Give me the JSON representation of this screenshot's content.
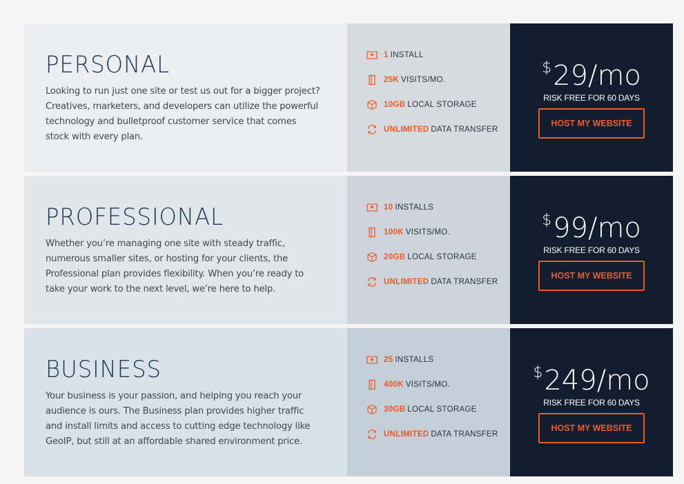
{
  "accent_color": "#ee5a24",
  "plans": [
    {
      "name": "PERSONAL",
      "description": "Looking to run just one site or test us out for a bigger project? Creatives, marketers, and developers can utilize the powerful technology and bulletproof customer service that comes stock with every plan.",
      "features": [
        {
          "icon": "install-icon",
          "value": "1",
          "label": "INSTALL"
        },
        {
          "icon": "visits-icon",
          "value": "25K",
          "label": "VISITS/MO."
        },
        {
          "icon": "storage-icon",
          "value": "10GB",
          "label": "LOCAL STORAGE"
        },
        {
          "icon": "transfer-icon",
          "value": "UNLIMITED",
          "label": "DATA TRANSFER"
        }
      ],
      "currency": "$",
      "price": "29",
      "period": "/mo",
      "guarantee": "RISK FREE FOR 60 DAYS",
      "cta": "HOST MY WEBSITE"
    },
    {
      "name": "PROFESSIONAL",
      "description": "Whether you’re managing one site with steady traffic, numerous smaller sites, or hosting for your clients, the Professional plan provides flexibility. When you’re ready to take your work to the next level, we’re here to help.",
      "features": [
        {
          "icon": "install-icon",
          "value": "10",
          "label": "INSTALLS"
        },
        {
          "icon": "visits-icon",
          "value": "100K",
          "label": "VISITS/MO."
        },
        {
          "icon": "storage-icon",
          "value": "20GB",
          "label": "LOCAL STORAGE"
        },
        {
          "icon": "transfer-icon",
          "value": "UNLIMITED",
          "label": "DATA TRANSFER"
        }
      ],
      "currency": "$",
      "price": "99",
      "period": "/mo",
      "guarantee": "RISK FREE FOR 60 DAYS",
      "cta": "HOST MY WEBSITE"
    },
    {
      "name": "BUSINESS",
      "description": "Your business is your passion, and helping you reach your audience is ours. The Business plan provides higher traffic and install limits and access to cutting edge technology like GeoIP, but still at an affordable shared environment price.",
      "features": [
        {
          "icon": "install-icon",
          "value": "25",
          "label": "INSTALLS"
        },
        {
          "icon": "visits-icon",
          "value": "400K",
          "label": "VISITS/MO."
        },
        {
          "icon": "storage-icon",
          "value": "30GB",
          "label": "LOCAL STORAGE"
        },
        {
          "icon": "transfer-icon",
          "value": "UNLIMITED",
          "label": "DATA TRANSFER"
        }
      ],
      "currency": "$",
      "price": "249",
      "period": "/mo",
      "guarantee": "RISK FREE FOR 60 DAYS",
      "cta": "HOST MY WEBSITE"
    }
  ]
}
